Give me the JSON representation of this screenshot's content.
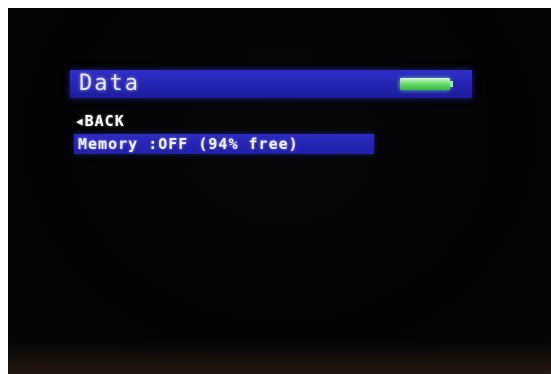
{
  "title_bar": {
    "title": "Data",
    "battery_icon": "battery-full-icon",
    "battery_color": "#5fdc5f"
  },
  "menu": {
    "back_icon": "left-triangle-icon",
    "back_arrow_glyph": "◀",
    "back_label": "BACK",
    "memory_label": "Memory :OFF (94% free)"
  },
  "colors": {
    "accent_blue": "#2525b5",
    "background": "#030304",
    "text": "#ffffff"
  }
}
